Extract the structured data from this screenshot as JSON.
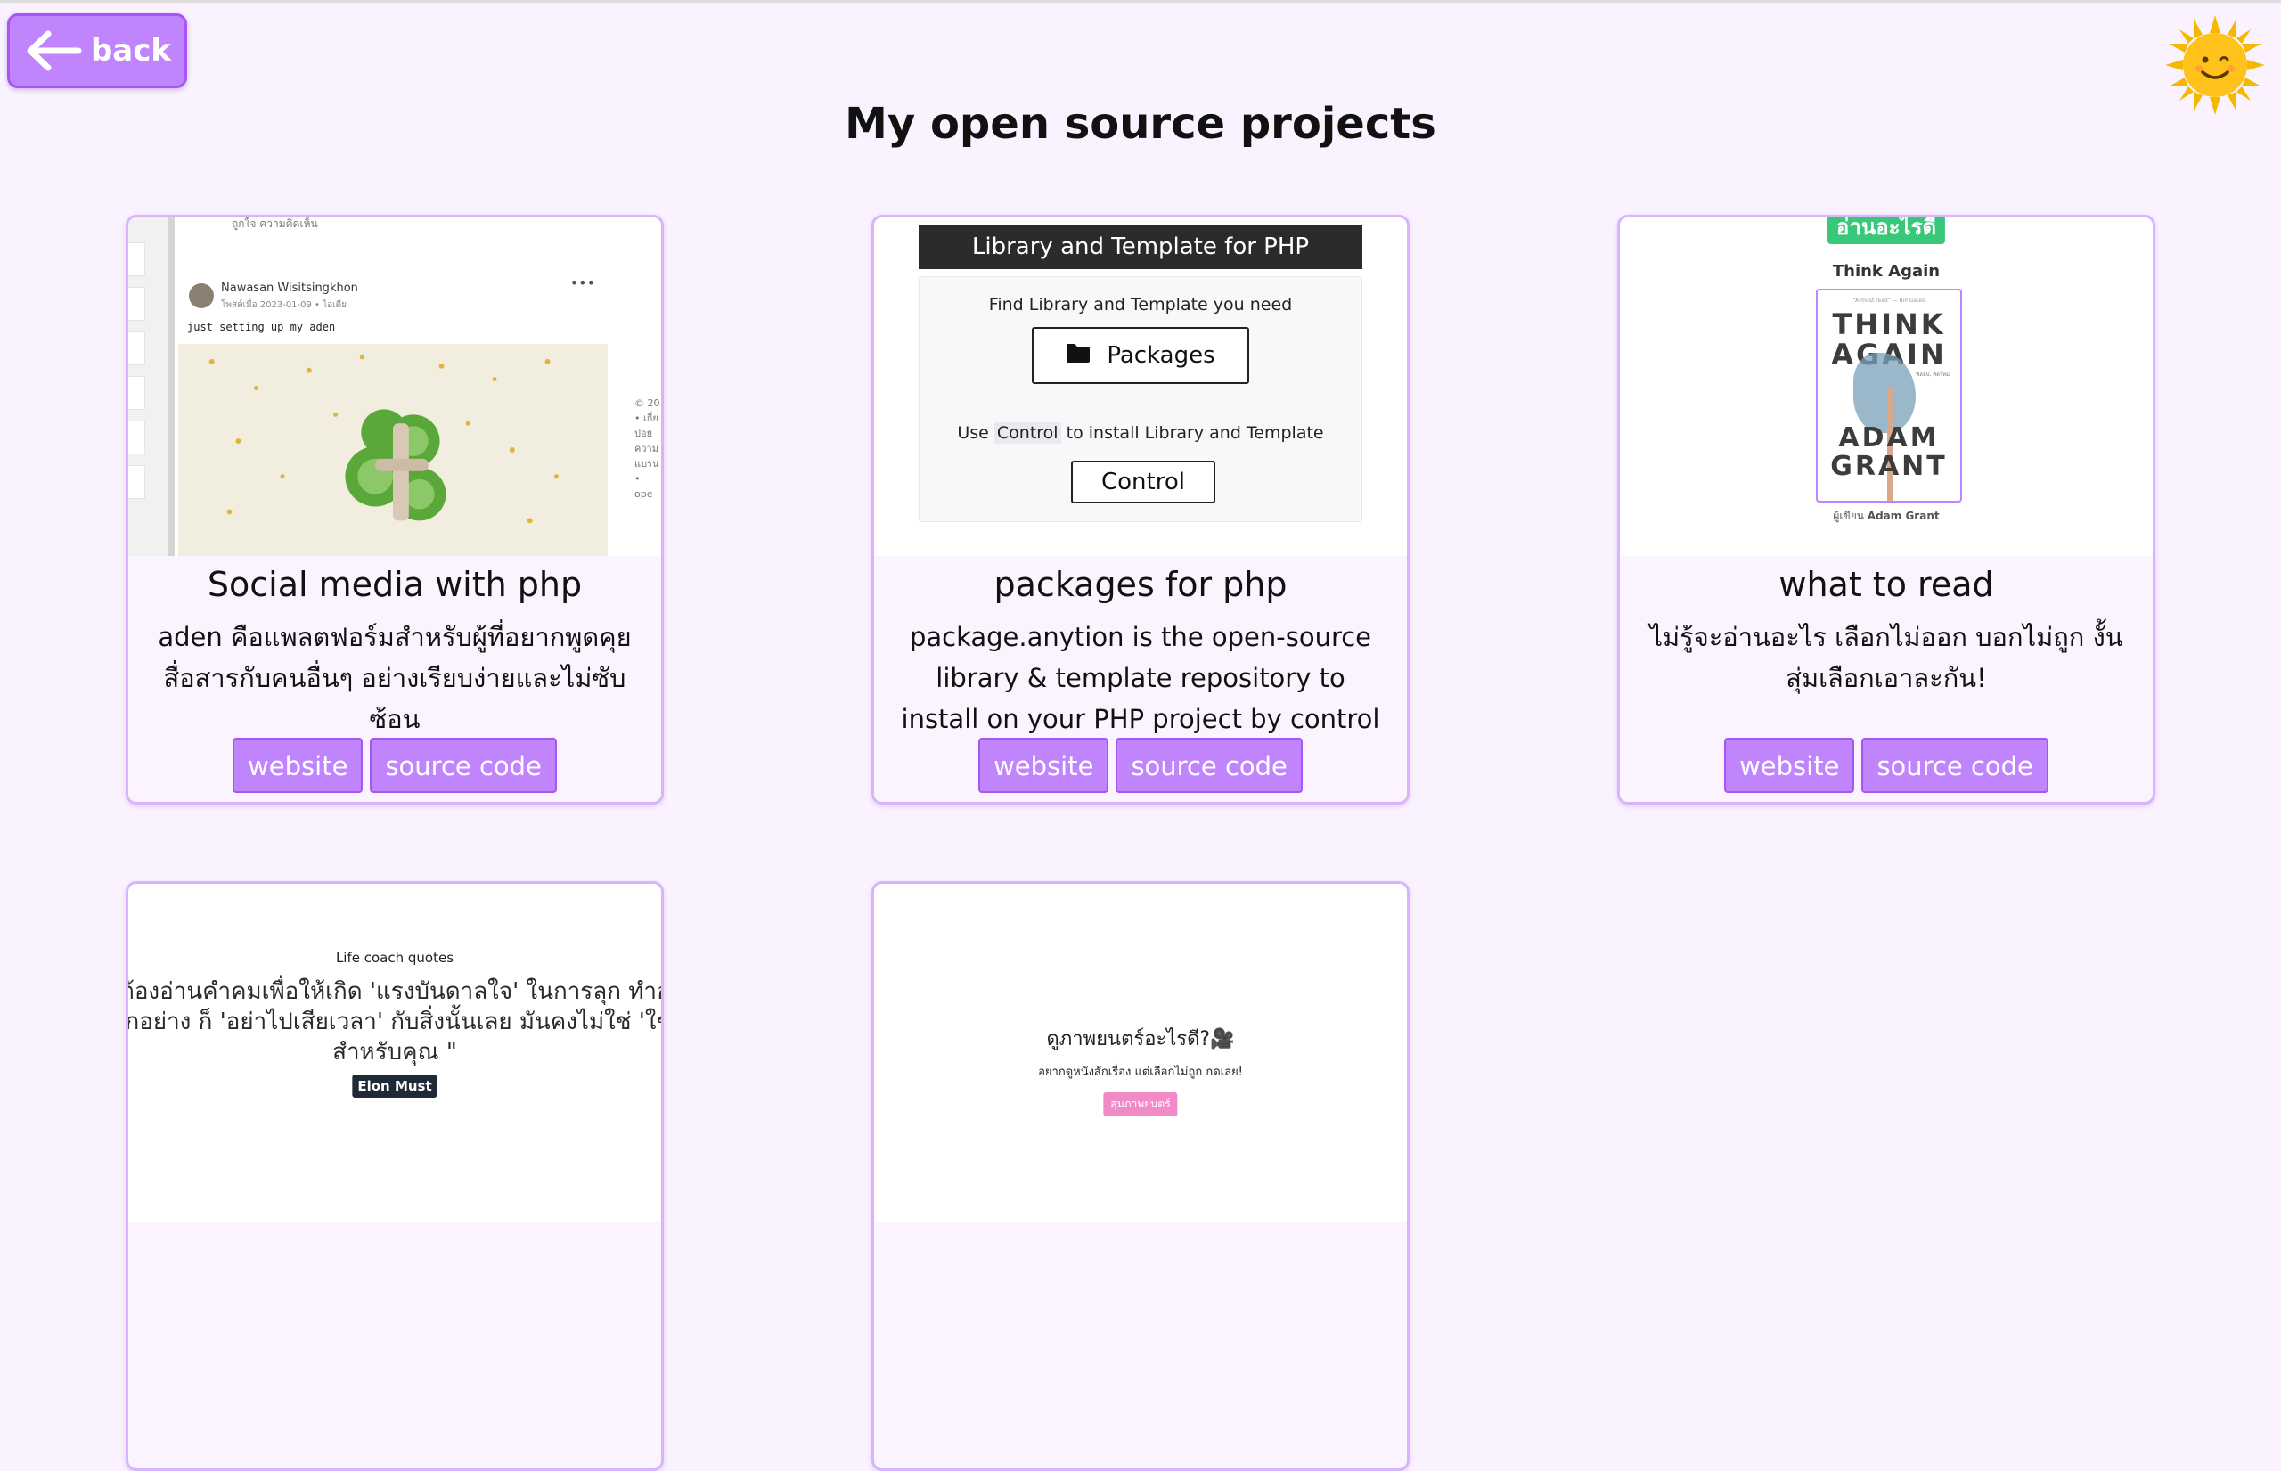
{
  "header": {
    "back_label": "back",
    "title": "My open source projects"
  },
  "projects": [
    {
      "title": "Social media with php",
      "description": "aden คือแพลตฟอร์มสำหรับผู้ที่อยากพูดคุยสื่อสารกับคนอื่นๆ อย่างเรียบง่ายและไม่ซับซ้อน",
      "website_label": "website",
      "source_label": "source code",
      "preview": {
        "top_bar_text": "ถูกใจ   ความคิดเห็น",
        "author": "Nawasan Wisitsingkhon",
        "meta": "โพสต์เมื่อ 2023-01-09 • ไอเดีย",
        "post_text": "just setting up my aden",
        "side_text": "© 20 • เกี่ย ปอย ความ แบรน • ope"
      }
    },
    {
      "title": "packages for php",
      "description": "package.anytion is the open-source library & template repository to install on your PHP project by control",
      "website_label": "website",
      "source_label": "source code",
      "preview": {
        "header": "Library and Template for PHP",
        "find_text": "Find Library and Template you need",
        "packages_label": "Packages",
        "use_prefix": "Use",
        "use_highlight": "Control",
        "use_suffix": "to install Library and Template",
        "control_label": "Control"
      }
    },
    {
      "title": "what to read",
      "description": "ไม่รู้จะอ่านอะไร เลือกไม่ออก บอกไม่ถูก งั้น สุ่มเลือกเอาละกัน!",
      "website_label": "website",
      "source_label": "source code",
      "preview": {
        "tag": "อ่านอะไรดี",
        "book_title": "Think Again",
        "cover_quote": "“A must read” — Bill Gates",
        "cover_top": "THINK AGAIN",
        "cover_sub": "ฟิลลิป, คิดใหม่",
        "cover_bottom": "ADAM GRANT",
        "author_prefix": "ผู้เขียน",
        "author": "Adam Grant"
      }
    },
    {
      "preview": {
        "title": "Life coach quotes",
        "quote": "คุณต้องอ่านคำคมเพื่อให้เกิด 'แรงบันดาลใจ' ในการลุก ทำอะไรสักอย่าง ก็ 'อย่าไปเสียเวลา' กับสิ่งนั้นเลย มันคงไม่ใช่ 'ใช่' สำหรับคุณ \"",
        "author": "Elon Must"
      }
    },
    {
      "preview": {
        "title": "ดูภาพยนตร์อะไรดี?🎥",
        "subtitle": "อยากดูหนังสักเรื่อง แต่เลือกไม่ถูก กดเลย!",
        "button": "สุ่มภาพยนตร์"
      }
    }
  ],
  "colors": {
    "background": "#faf3ff",
    "accent": "#c084fc",
    "accent_border": "#a855f7",
    "card_border": "#d8b4fe"
  },
  "icons": {
    "back": "arrow-left-icon",
    "theme": "sun-icon",
    "folder": "folder-icon"
  }
}
